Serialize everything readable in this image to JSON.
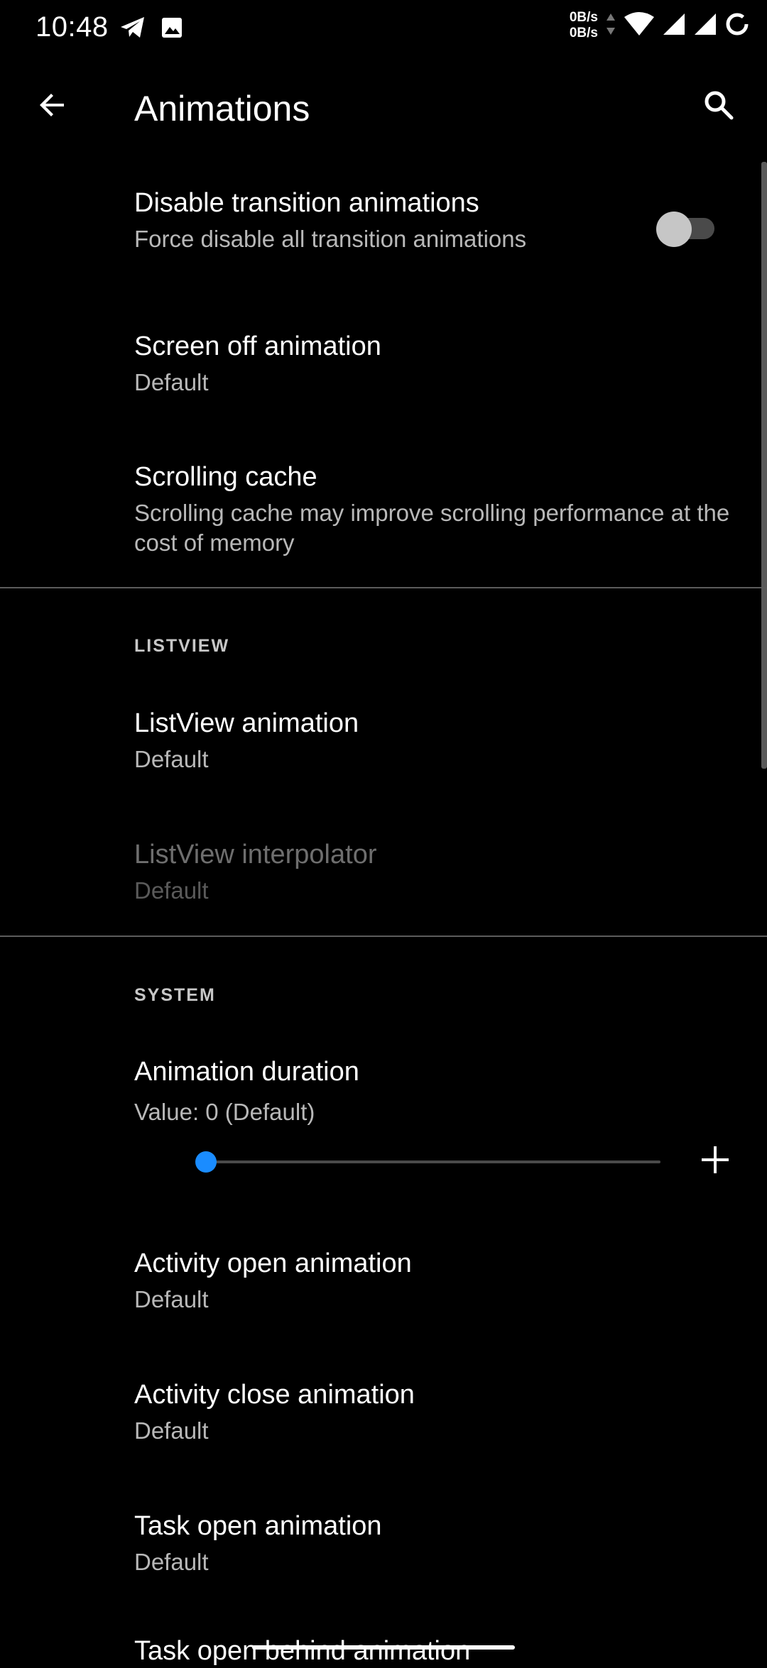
{
  "status_bar": {
    "time": "10:48",
    "left_icons": [
      "telegram-icon",
      "image-icon"
    ],
    "net_up": "0B/s",
    "net_down": "0B/s",
    "right_icons": [
      "wifi-icon",
      "signal-icon",
      "signal-icon",
      "battery-circle-icon"
    ]
  },
  "app_bar": {
    "title": "Animations",
    "back_icon": "arrow-left-icon",
    "search_icon": "search-icon"
  },
  "prefs": {
    "disable_transition": {
      "title": "Disable transition animations",
      "summary": "Force disable all transition animations",
      "checked": false
    },
    "screen_off": {
      "title": "Screen off animation",
      "summary": "Default"
    },
    "scrolling_cache": {
      "title": "Scrolling cache",
      "summary": "Scrolling cache may improve scrolling performance at the cost of memory"
    },
    "listview_category": "LISTVIEW",
    "listview_animation": {
      "title": "ListView animation",
      "summary": "Default"
    },
    "listview_interpolator": {
      "title": "ListView interpolator",
      "summary": "Default",
      "enabled": false
    },
    "system_category": "SYSTEM",
    "animation_duration": {
      "title": "Animation duration",
      "summary": "Value: 0 (Default)",
      "value_fraction": 0
    },
    "activity_open": {
      "title": "Activity open animation",
      "summary": "Default"
    },
    "activity_close": {
      "title": "Activity close animation",
      "summary": "Default"
    },
    "task_open": {
      "title": "Task open animation",
      "summary": "Default"
    },
    "task_open_behind": {
      "title": "Task open behind animation"
    }
  },
  "colors": {
    "background": "#000000",
    "accent": "#1a8cff",
    "text_primary": "#ffffff",
    "text_secondary": "#b8b8b8",
    "divider": "#5c5c5c"
  }
}
